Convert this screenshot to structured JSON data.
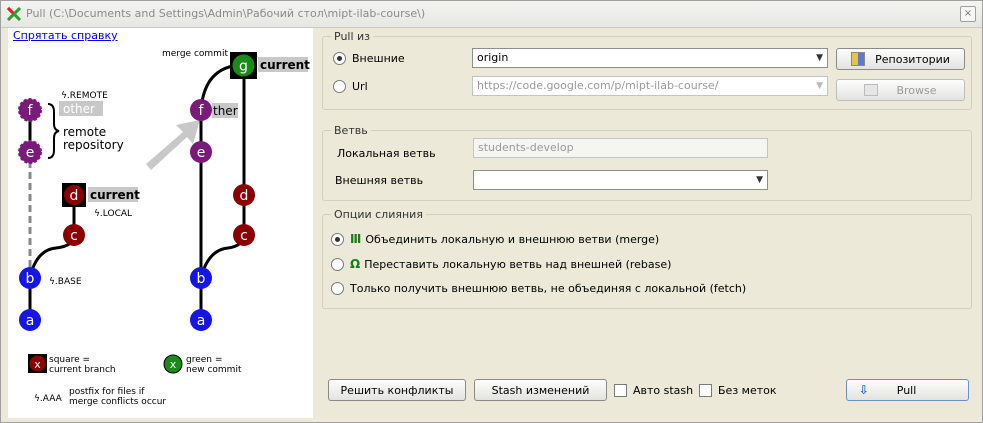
{
  "window": {
    "title": "Pull (C:\\Documents and Settings\\Admin\\Рабочий стол\\mipt-ilab-course\\)",
    "close_glyph": "×",
    "app_icon": "tortoisegit-x-icon"
  },
  "help": {
    "hide_link": "Спрятать справку",
    "labels": {
      "merge_commit": "merge commit",
      "remote_tag": "ϟ.REMOTE",
      "other_tag": "other",
      "remote_line1": "remote",
      "remote_line2": "repository",
      "current_left": "current",
      "local_tag": "ϟ.LOCAL",
      "base_tag": "ϟ.BASE",
      "current_right": "current",
      "other_right": "ther",
      "legend_square_1": "square =",
      "legend_square_2": "current branch",
      "legend_green_1": "green =",
      "legend_green_2": "new commit",
      "legend_aaa": "ϟ.AAA",
      "legend_postfix_1": "postfix for files if",
      "legend_postfix_2": "merge conflicts occur"
    },
    "nodes": {
      "a": "a",
      "b": "b",
      "c": "c",
      "d": "d",
      "e": "e",
      "f": "f",
      "g": "g",
      "x": "x"
    },
    "colors": {
      "blue": "#1515e6",
      "red": "#8b0000",
      "purple": "#7a1a7a",
      "green": "#1a8a1a",
      "tag_bg": "#c8c8c8",
      "arrow": "#c8c8c8"
    }
  },
  "pull_from": {
    "legend": "Pull из",
    "remote_label": "Внешние",
    "remote_selected": true,
    "remote_value": "origin",
    "repos_button": "Репозитории",
    "url_label": "Url",
    "url_selected": false,
    "url_value": "https://code.google.com/p/mipt-ilab-course/",
    "browse_button": "Browse"
  },
  "branch": {
    "legend": "Ветвь",
    "local_label": "Локальная ветвь",
    "local_value": "students-develop",
    "remote_label": "Внешняя ветвь",
    "remote_value": ""
  },
  "merge_options": {
    "legend": "Опции слияния",
    "options": [
      {
        "label": "Объединить локальную и внешнюю ветви (merge)",
        "selected": true,
        "icon": "merge-icon"
      },
      {
        "label": "Переставить локальную ветвь над внешней (rebase)",
        "selected": false,
        "icon": "rebase-icon"
      },
      {
        "label": "Только получить внешнюю ветвь, не объединяя с локальной (fetch)",
        "selected": false,
        "icon": ""
      }
    ]
  },
  "footer": {
    "resolve_button": "Решить конфликты",
    "stash_button": "Stash изменений",
    "auto_stash_label": "Авто stash",
    "auto_stash_checked": false,
    "no_tags_label": "Без меток",
    "no_tags_checked": false,
    "pull_button": "Pull"
  }
}
